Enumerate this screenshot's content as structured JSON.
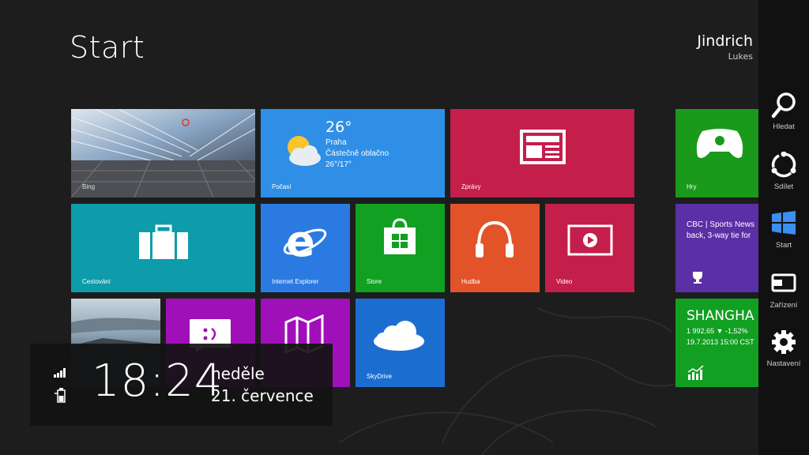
{
  "screen": {
    "title": "Start",
    "user": {
      "first_name": "Jindrich",
      "last_name": "Lukes"
    }
  },
  "tiles": {
    "bing": {
      "label": "Bing",
      "color": "#6f8aa8"
    },
    "weather": {
      "label": "Počasí",
      "temp": "26°",
      "city": "Praha",
      "condition": "Částečně oblačno",
      "range": "26°/17°",
      "color": "#2f8ee5"
    },
    "news": {
      "label": "Zprávy",
      "color": "#c41e4a"
    },
    "games": {
      "label": "Hry",
      "color": "#1a9a1a"
    },
    "travel": {
      "label": "Cestování",
      "color": "#0e9baa"
    },
    "ie": {
      "label": "Internet Explorer",
      "color": "#2a7ae2"
    },
    "store": {
      "label": "Store",
      "color": "#11a021"
    },
    "music": {
      "label": "Hudba",
      "color": "#e2532a"
    },
    "video": {
      "label": "Video",
      "color": "#c41e4a"
    },
    "sports": {
      "headline_line1": "CBC | Sports News",
      "headline_line2": "back, 3-way tie for",
      "color": "#5b2fa6"
    },
    "photos": {
      "color": "#3a5a6a"
    },
    "messaging": {
      "color": "#a010b8"
    },
    "maps": {
      "color": "#a010b8"
    },
    "skydrive": {
      "label": "SkyDrive",
      "color": "#1b6ed0"
    },
    "finance": {
      "title": "SHANGHA",
      "line1": "1 992,65 ▼ -1,52%",
      "line2": "19.7.2013 15:00 CST",
      "color": "#11a021"
    }
  },
  "charms": [
    {
      "label": "Hledat",
      "icon": "search-icon"
    },
    {
      "label": "Sdílet",
      "icon": "share-icon"
    },
    {
      "label": "Start",
      "icon": "windows-icon"
    },
    {
      "label": "Zařízení",
      "icon": "devices-icon"
    },
    {
      "label": "Nastavení",
      "icon": "settings-icon"
    }
  ],
  "clock": {
    "time": "18:24",
    "day": "neděle",
    "date": "21. července"
  }
}
